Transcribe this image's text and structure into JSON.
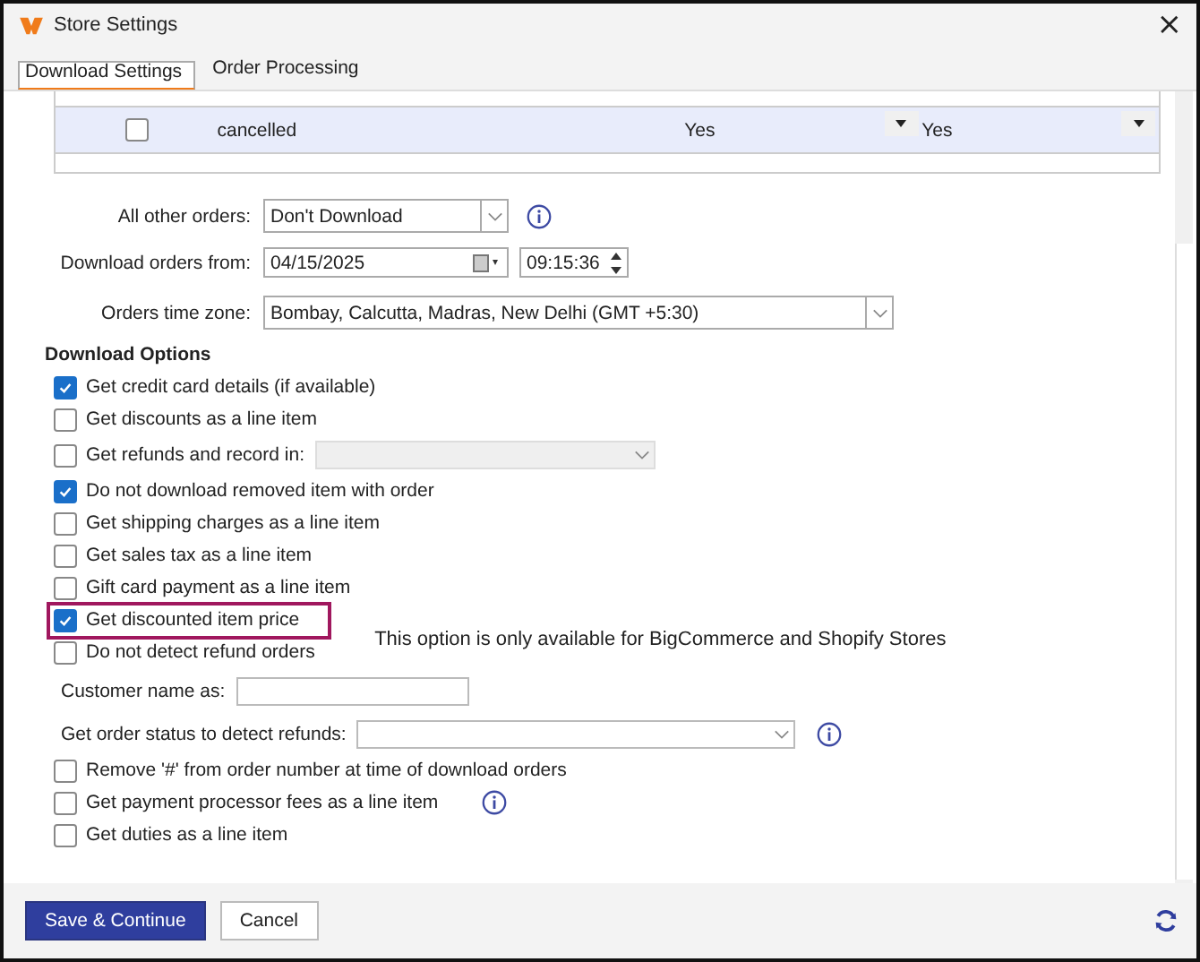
{
  "window": {
    "title": "Store Settings",
    "close": "×"
  },
  "tabs": [
    {
      "label": "Download Settings",
      "selected": true
    },
    {
      "label": "Order Processing",
      "selected": false
    }
  ],
  "table": {
    "rows": [
      {
        "checked": false,
        "selected": true,
        "column_2": "cancelled",
        "column_3": "Yes",
        "column_4": "Yes"
      }
    ]
  },
  "fields": [
    {
      "label": "All other orders:",
      "kind": "select",
      "value": "Don't Download",
      "info": true
    },
    {
      "label": "Download orders from:",
      "kind": "datetime",
      "value": "04/15/2025",
      "time": "09:15:36"
    },
    {
      "label": "Orders time zone:",
      "kind": "wide-select",
      "value": "Bombay, Calcutta, Madras, New Delhi (GMT +5:30)"
    }
  ],
  "section_title": "Download Options",
  "options": [
    {
      "kind": "checkbox",
      "label": "Get credit card details (if available)",
      "checked": true
    },
    {
      "kind": "checkbox",
      "label": "Get discounts as a line item",
      "checked": false
    },
    {
      "kind": "checkbox-select",
      "label": "Get refunds and record in:",
      "checked": false,
      "disabled": true
    },
    {
      "kind": "checkbox",
      "label": "Do not download removed item with order",
      "checked": true
    },
    {
      "kind": "checkbox",
      "label": "Get shipping charges as a line item",
      "checked": false
    },
    {
      "kind": "checkbox",
      "label": "Get sales tax as a line item",
      "checked": false
    },
    {
      "kind": "checkbox",
      "label": "Gift card payment as a line item",
      "checked": false
    },
    {
      "kind": "checkbox",
      "label": "Get discounted item price",
      "checked": true,
      "highlighted": true,
      "note": "This option is only available for BigCommerce and Shopify Stores"
    },
    {
      "kind": "checkbox",
      "label": "Do not detect refund orders",
      "checked": false
    },
    {
      "kind": "text-field",
      "label": "Customer name as:"
    },
    {
      "kind": "select",
      "label": "Get order status to detect refunds:",
      "info": true
    },
    {
      "kind": "checkbox",
      "label": "Remove '#' from order number at time of download orders",
      "checked": false
    },
    {
      "kind": "checkbox",
      "label": "Get payment processor fees as a line item",
      "checked": false,
      "info": true
    },
    {
      "kind": "checkbox",
      "label": "Get duties as a line item",
      "checked": false
    }
  ],
  "buttons": [
    {
      "label": "Save & Continue",
      "kind": "primary"
    },
    {
      "label": "Cancel",
      "kind": "secondary"
    }
  ]
}
